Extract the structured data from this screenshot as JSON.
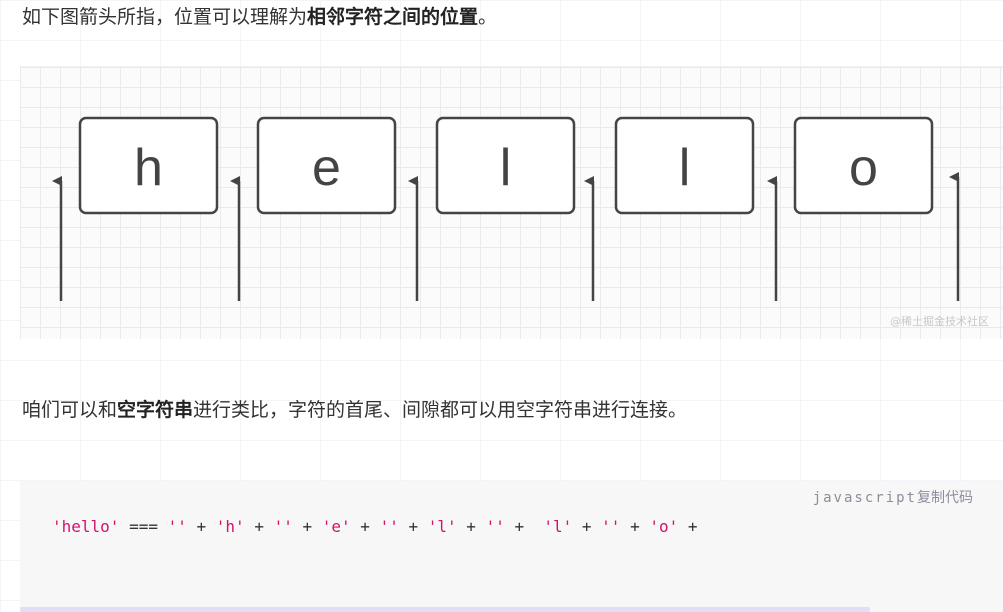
{
  "intro": {
    "prefix": "如下图箭头所指，位置可以理解为",
    "bold": "相邻字符之间的位置",
    "suffix": "。"
  },
  "figure": {
    "letters": [
      "h",
      "e",
      "l",
      "l",
      "o"
    ],
    "watermark": "@稀土掘金技术社区"
  },
  "para2": {
    "prefix": "咱们可以和",
    "bold": "空字符串",
    "suffix": "进行类比，字符的首尾、间隙都可以用空字符串进行连接。"
  },
  "code": {
    "language": "javascript",
    "copy_label": "复制代码",
    "tokens": [
      {
        "t": "'hello'",
        "k": "str"
      },
      {
        "t": " === ",
        "k": "op"
      },
      {
        "t": "''",
        "k": "str"
      },
      {
        "t": " + ",
        "k": "op"
      },
      {
        "t": "'h'",
        "k": "str"
      },
      {
        "t": " + ",
        "k": "op"
      },
      {
        "t": "''",
        "k": "str"
      },
      {
        "t": " + ",
        "k": "op"
      },
      {
        "t": "'e'",
        "k": "str"
      },
      {
        "t": " + ",
        "k": "op"
      },
      {
        "t": "''",
        "k": "str"
      },
      {
        "t": " + ",
        "k": "op"
      },
      {
        "t": "'l'",
        "k": "str"
      },
      {
        "t": " + ",
        "k": "op"
      },
      {
        "t": "''",
        "k": "str"
      },
      {
        "t": " +  ",
        "k": "op"
      },
      {
        "t": "'l'",
        "k": "str"
      },
      {
        "t": " + ",
        "k": "op"
      },
      {
        "t": "''",
        "k": "str"
      },
      {
        "t": " + ",
        "k": "op"
      },
      {
        "t": "'o'",
        "k": "str"
      },
      {
        "t": " + ",
        "k": "op"
      }
    ]
  }
}
